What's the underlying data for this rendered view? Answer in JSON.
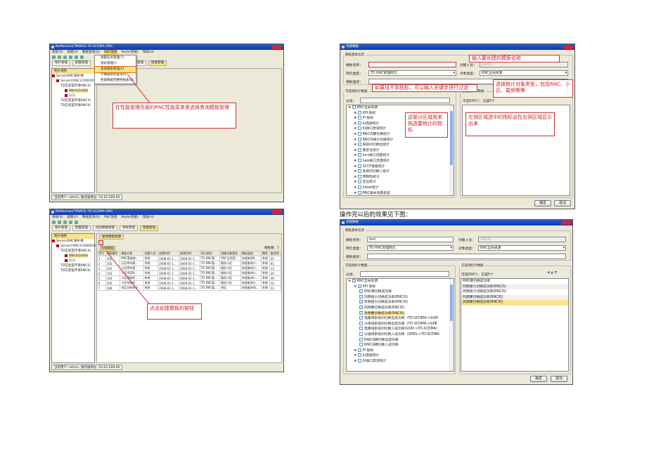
{
  "omc": {
    "title": "NetNumen(TM)M31 TD-SCDMA OMC",
    "menu": [
      "系统(S)",
      "视图(V)",
      "数据查询(Q)",
      "RNC性能",
      "Node(性能)",
      "帮助(H)"
    ],
    "tabs1": [
      "拓扑管理",
      "配置管理",
      "系统管理",
      "性能管理"
    ],
    "tabs3": [
      "拓扑管理",
      "配置管理",
      "动态数据管理",
      "系统管理",
      "性能管理"
    ],
    "tree_header": "拓扑视图",
    "tree": [
      "ServerOMC拓扑根",
      "Server(OMC)(1000001)",
      "TD实验室环境RNC4(",
      "RNC4(1000)",
      "1(1)",
      "TD实验室环境RNC5(",
      "TD实验室环境RNC6("
    ],
    "status": "当前用户: admin, 服务器地址: 10.63.208.69"
  },
  "shot1": {
    "dropdown": [
      "测量任务管理(T)",
      "指标管理(I)",
      "查询模板管理(E)",
      "计数器即时查询(R)",
      "性能数据完整性报表(D)"
    ],
    "callout": "在性能管理页面的RNC性能菜单里选择查询模板管理"
  },
  "shot3": {
    "subtab": "查询模板管理",
    "tooltip": "创建模板",
    "count_label": "模板数：7",
    "columns": [
      "序号",
      "模板编号",
      "模板名称",
      "创建人员",
      "创建时间",
      "修改时间",
      "网元类型",
      "测量对象类型",
      "模板描述",
      "属性",
      "查询项"
    ],
    "rows": [
      [
        "1",
        "100",
        "RNC基础统…",
        "系统",
        "2008-01-1…",
        "2008-01-1…",
        "TD RNC管…",
        "RNC全局资…",
        "快速查询R…",
        "系统",
        "30"
      ],
      [
        "2",
        "101",
        "小区呼叫建…",
        "系统",
        "2008-01-1…",
        "2008-01-1…",
        "TD RNC管…",
        "服务小区",
        "快速查询小…",
        "系统",
        "61"
      ],
      [
        "3",
        "102",
        "小区呼叫保…",
        "系统",
        "2008-01-1…",
        "2008-01-1…",
        "TD RNC管…",
        "服务小区",
        "快速查询小…",
        "系统",
        "13"
      ],
      [
        "4",
        "103",
        "小区HSDP…",
        "系统",
        "2008-01-1…",
        "2008-01-1…",
        "TD RNC管…",
        "服务小区",
        "快速查询小…",
        "系统",
        "20"
      ],
      [
        "5",
        "104",
        "小区基础性…",
        "系统",
        "2008-01-1…",
        "2008-01-1…",
        "TD RNC管…",
        "服务小区",
        "快速查询小…",
        "系统",
        "39"
      ],
      [
        "6",
        "105",
        "小区系统间…",
        "系统",
        "2008-01-1…",
        "2008-01-1…",
        "TD RNC管…",
        "服务小区",
        "快速查询小…",
        "系统",
        "10"
      ],
      [
        "7",
        "106",
        "邻区关系统计…",
        "系统",
        "2008-01-1…",
        "2008-01-1…",
        "TD RNC管…",
        "邻区",
        "快速查询邻…",
        "系统",
        "13"
      ]
    ],
    "callout": "点击创建模板的按钮"
  },
  "dialog": {
    "title": "创建模板",
    "basic_group": "模板基本信息",
    "name_label": "模板名称：",
    "creator_label": "创建人员：",
    "creator_value": "admin",
    "ne_type_label": "网元类型：",
    "ne_type_value": "TD RNC管理网元",
    "obj_type_label": "对象类型：",
    "obj_type_value": "RNC全局资源",
    "desc_label": "模板描述：",
    "left_group": "可选指标计数器",
    "filter_label": "过滤：",
    "right_group": "已选指标计数器",
    "ok": "确定",
    "cancel": "取消"
  },
  "shot2": {
    "name_value": "",
    "selected_count": "可选500个，已选0个",
    "tree": [
      "RNC全局资源",
      "KPI 指标",
      "PI 指标",
      "Iu连接统计",
      "IU接口异常统计",
      "RNC内硬切换统计",
      "RNC内接力切换统计",
      "系统间切换出统计",
      "重定位统计",
      "Iucs接口流量统计",
      "Iups接口流量统计",
      "SCCP性能统计",
      "系统间切换入统计",
      "MBMS统计",
      "定位统计",
      "Iufast统计",
      "RNC基本测量类型"
    ],
    "callouts": [
      "输入要创建的模板名称",
      "选择统计对象类型，包括RNC、小区、载频等等",
      "如果找不到指标，可以输入关键字进行过滤",
      "这部分区域用来挑选要统计的指标",
      "左侧区域选中的指标会在右侧区域显示出来"
    ]
  },
  "caption": "操作完以后的效果见下图：",
  "shot4": {
    "name_value": "test",
    "selected_count": "可选500个，已选5个",
    "tree": [
      {
        "t": "RNC全局资源",
        "lvl": 0,
        "chk": true
      },
      {
        "t": "KPI 指标",
        "lvl": 1,
        "chk": true
      },
      {
        "t": "RNC硬切换成功率",
        "lvl": 2,
        "chk": true
      },
      {
        "t": "同频接力切换成功率(RNC内)",
        "lvl": 2,
        "chk": true
      },
      {
        "t": "异频接力切换成功率(RNC内)",
        "lvl": 2,
        "chk": true
      },
      {
        "t": "同频硬切换成功率(RNC内)",
        "lvl": 2,
        "chk": true
      },
      {
        "t": "异频硬切换成功率(RNC内)",
        "lvl": 2,
        "chk": true,
        "hl": true
      },
      {
        "t": "电路域系统间切换出成功率（TD-SCDMA->GSM",
        "lvl": 2,
        "chk": false
      },
      {
        "t": "分组域系统间切换出成功率（TD-SCDMA->GPR",
        "lvl": 2,
        "chk": false
      },
      {
        "t": "电路域系统间切换入成功率(GSM->TD-SCDMA)",
        "lvl": 2,
        "chk": false
      },
      {
        "t": "分组域系统间切换入成功率（GPRS->TD-SCDMA",
        "lvl": 2,
        "chk": false
      },
      {
        "t": "RNC间硬切换出成功率",
        "lvl": 2,
        "chk": false
      },
      {
        "t": "RNC间硬切换入成功率",
        "lvl": 2,
        "chk": false
      },
      {
        "t": "PI 指标",
        "lvl": 1,
        "chk": false
      },
      {
        "t": "Iu连接统计",
        "lvl": 1,
        "chk": false
      },
      {
        "t": "IU接口异常统计",
        "lvl": 1,
        "chk": false
      }
    ],
    "selected": [
      "RNC硬切换成功率",
      "同频接力切换成功率(RNC内)",
      "异频接力切换成功率(RNC内)",
      "同频硬切换成功率(RNC内)",
      "异频硬切换成功率(RNC内)"
    ]
  }
}
